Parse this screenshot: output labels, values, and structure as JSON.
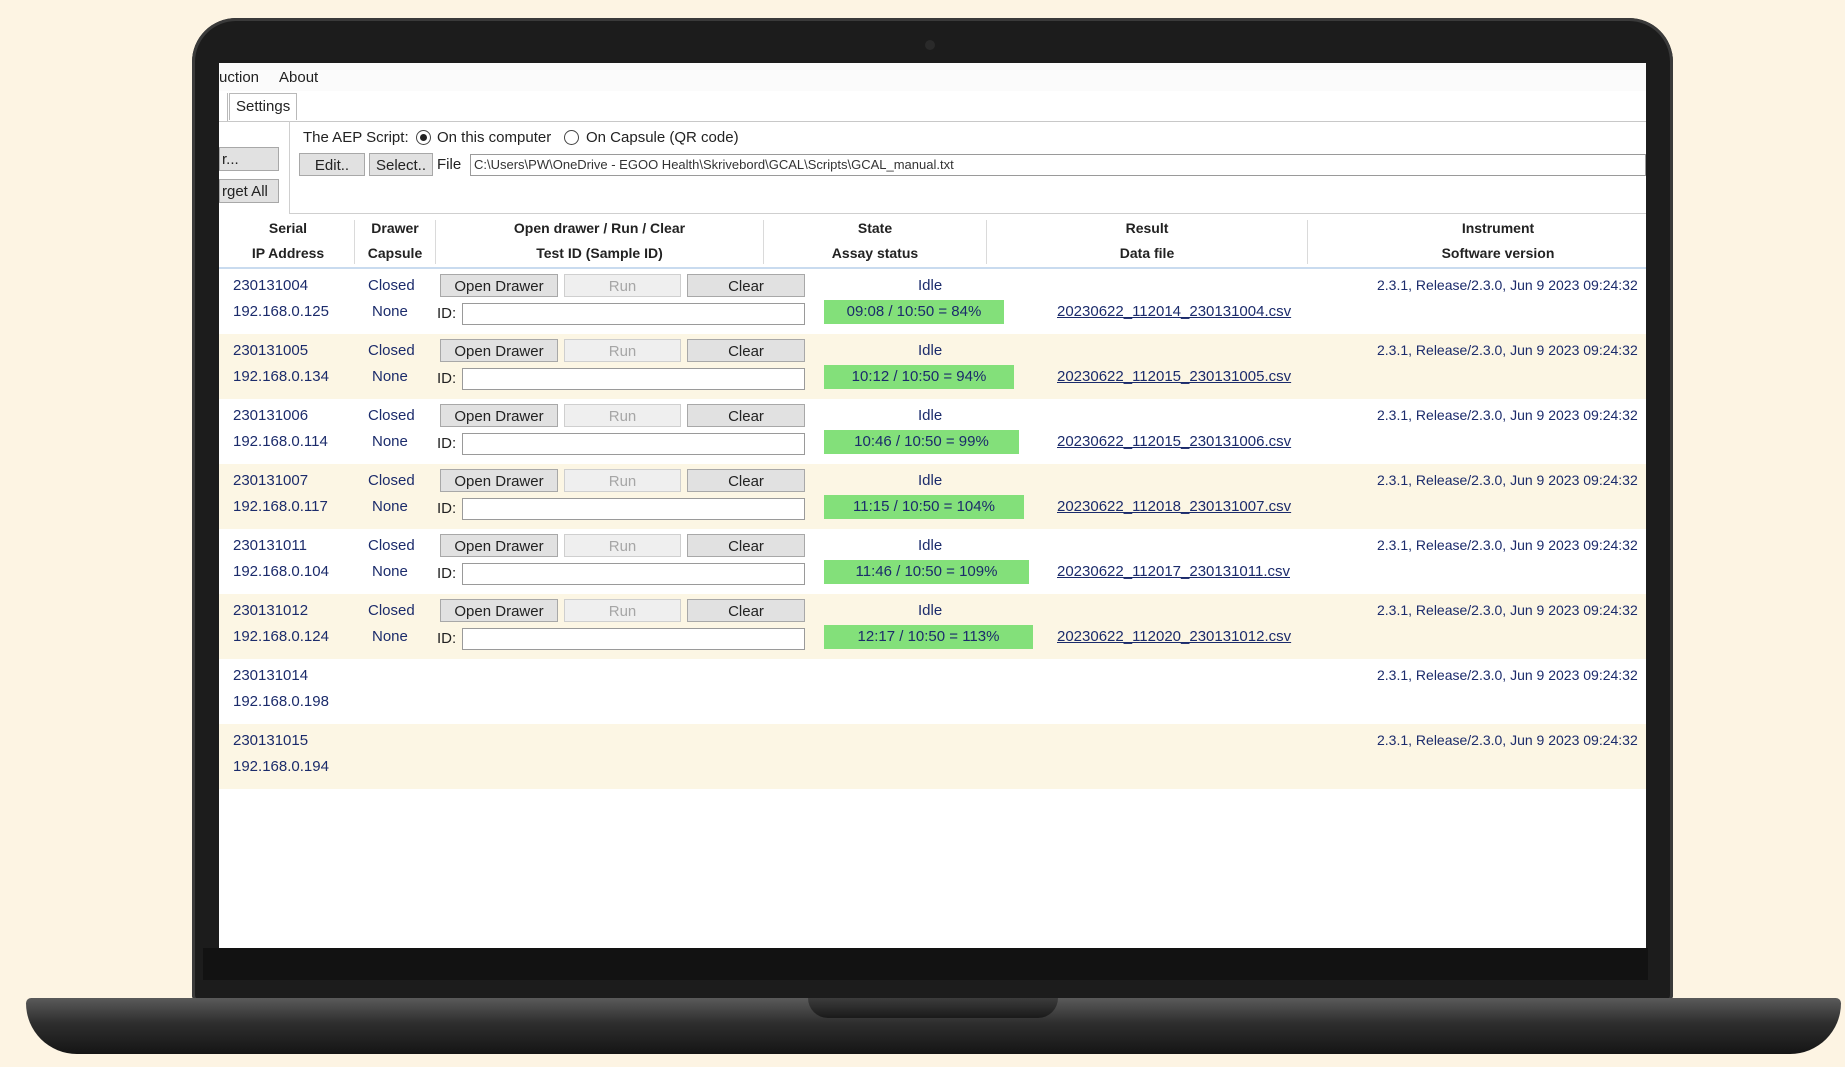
{
  "menu": {
    "items": [
      "uction",
      "About"
    ]
  },
  "tabs": {
    "settings": "Settings"
  },
  "script": {
    "label": "The AEP Script:",
    "option_local": "On this computer",
    "option_capsule": "On Capsule (QR code)",
    "edit_label": "Edit..",
    "select_label": "Select..",
    "file_label": "File",
    "file_path": "C:\\Users\\PW\\OneDrive - EGOO Health\\Skrivebord\\GCAL\\Scripts\\GCAL_manual.txt"
  },
  "left_buttons": {
    "top": "r...",
    "forget_all": "rget All"
  },
  "headers": {
    "serial": "Serial",
    "ip": "IP Address",
    "drawer": "Drawer",
    "capsule": "Capsule",
    "open_run_clear": "Open drawer / Run / Clear",
    "test_id": "Test ID (Sample ID)",
    "state": "State",
    "assay_status": "Assay status",
    "result": "Result",
    "data_file": "Data file",
    "instrument": "Instrument",
    "software_version": "Software version"
  },
  "row_controls": {
    "open_drawer": "Open Drawer",
    "run": "Run",
    "clear": "Clear",
    "id_label": "ID:"
  },
  "rows": [
    {
      "serial": "230131004",
      "ip": "192.168.0.125",
      "drawer": "Closed",
      "capsule": "None",
      "state": "Idle",
      "status": "09:08 / 10:50 = 84%",
      "progress": 84,
      "file": "20230622_112014_230131004.csv",
      "software": "2.3.1, Release/2.3.0, Jun  9 2023 09:24:32"
    },
    {
      "serial": "230131005",
      "ip": "192.168.0.134",
      "drawer": "Closed",
      "capsule": "None",
      "state": "Idle",
      "status": "10:12 / 10:50 = 94%",
      "progress": 94,
      "file": "20230622_112015_230131005.csv",
      "software": "2.3.1, Release/2.3.0, Jun  9 2023 09:24:32"
    },
    {
      "serial": "230131006",
      "ip": "192.168.0.114",
      "drawer": "Closed",
      "capsule": "None",
      "state": "Idle",
      "status": "10:46 / 10:50 = 99%",
      "progress": 99,
      "file": "20230622_112015_230131006.csv",
      "software": "2.3.1, Release/2.3.0, Jun  9 2023 09:24:32"
    },
    {
      "serial": "230131007",
      "ip": "192.168.0.117",
      "drawer": "Closed",
      "capsule": "None",
      "state": "Idle",
      "status": "11:15 / 10:50 = 104%",
      "progress": 104,
      "file": "20230622_112018_230131007.csv",
      "software": "2.3.1, Release/2.3.0, Jun  9 2023 09:24:32"
    },
    {
      "serial": "230131011",
      "ip": "192.168.0.104",
      "drawer": "Closed",
      "capsule": "None",
      "state": "Idle",
      "status": "11:46 / 10:50 = 109%",
      "progress": 109,
      "file": "20230622_112017_230131011.csv",
      "software": "2.3.1, Release/2.3.0, Jun  9 2023 09:24:32"
    },
    {
      "serial": "230131012",
      "ip": "192.168.0.124",
      "drawer": "Closed",
      "capsule": "None",
      "state": "Idle",
      "status": "12:17 / 10:50 = 113%",
      "progress": 113,
      "file": "20230622_112020_230131012.csv",
      "software": "2.3.1, Release/2.3.0, Jun  9 2023 09:24:32"
    },
    {
      "serial": "230131014",
      "ip": "192.168.0.198",
      "software": "2.3.1, Release/2.3.0, Jun  9 2023 09:24:32"
    },
    {
      "serial": "230131015",
      "ip": "192.168.0.194",
      "software": "2.3.1, Release/2.3.0, Jun  9 2023 09:24:32"
    }
  ],
  "colors": {
    "status_green": "#83e07a",
    "alt_row": "#fcf6e4",
    "text_navy": "#1b2b6b",
    "background": "#fdf4e3"
  }
}
